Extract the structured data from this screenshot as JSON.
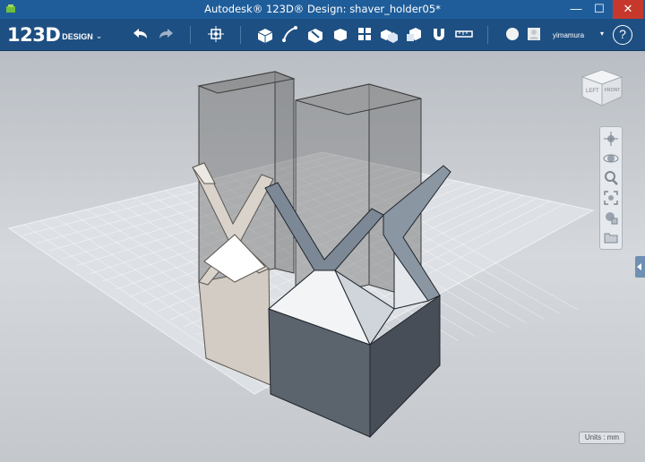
{
  "window": {
    "title": "Autodesk® 123D® Design: shaver_holder05*",
    "min_glyph": "—",
    "max_glyph": "☐",
    "close_glyph": "✕"
  },
  "logo": {
    "main": "123D",
    "sub": "DESIGN",
    "caret": "⌄"
  },
  "toolbar": {
    "tools": [
      {
        "name": "undo-icon"
      },
      {
        "name": "redo-icon"
      },
      {
        "name": "transform-icon"
      },
      {
        "name": "primitives-icon"
      },
      {
        "name": "sketch-icon"
      },
      {
        "name": "construct-icon"
      },
      {
        "name": "modify-icon"
      },
      {
        "name": "pattern-icon"
      },
      {
        "name": "group-icon"
      },
      {
        "name": "combine-icon"
      },
      {
        "name": "snap-icon"
      },
      {
        "name": "measure-icon"
      },
      {
        "name": "material-icon"
      },
      {
        "name": "avatar-icon"
      }
    ],
    "user": "yimamura",
    "user_caret": "▾",
    "help": "?"
  },
  "viewcube": {
    "face": "LEFT",
    "side": "FRONT"
  },
  "units_label": "Units : mm",
  "colors": {
    "titlebar": "#1f5d9a",
    "toolbar": "#1d4f82",
    "viewport_bg": "#c9cdd2",
    "grid": "#ffffff",
    "model_light": "#d4cfc8",
    "model_dark": "#5b636d",
    "ghost_box": "#7d7d7d"
  }
}
